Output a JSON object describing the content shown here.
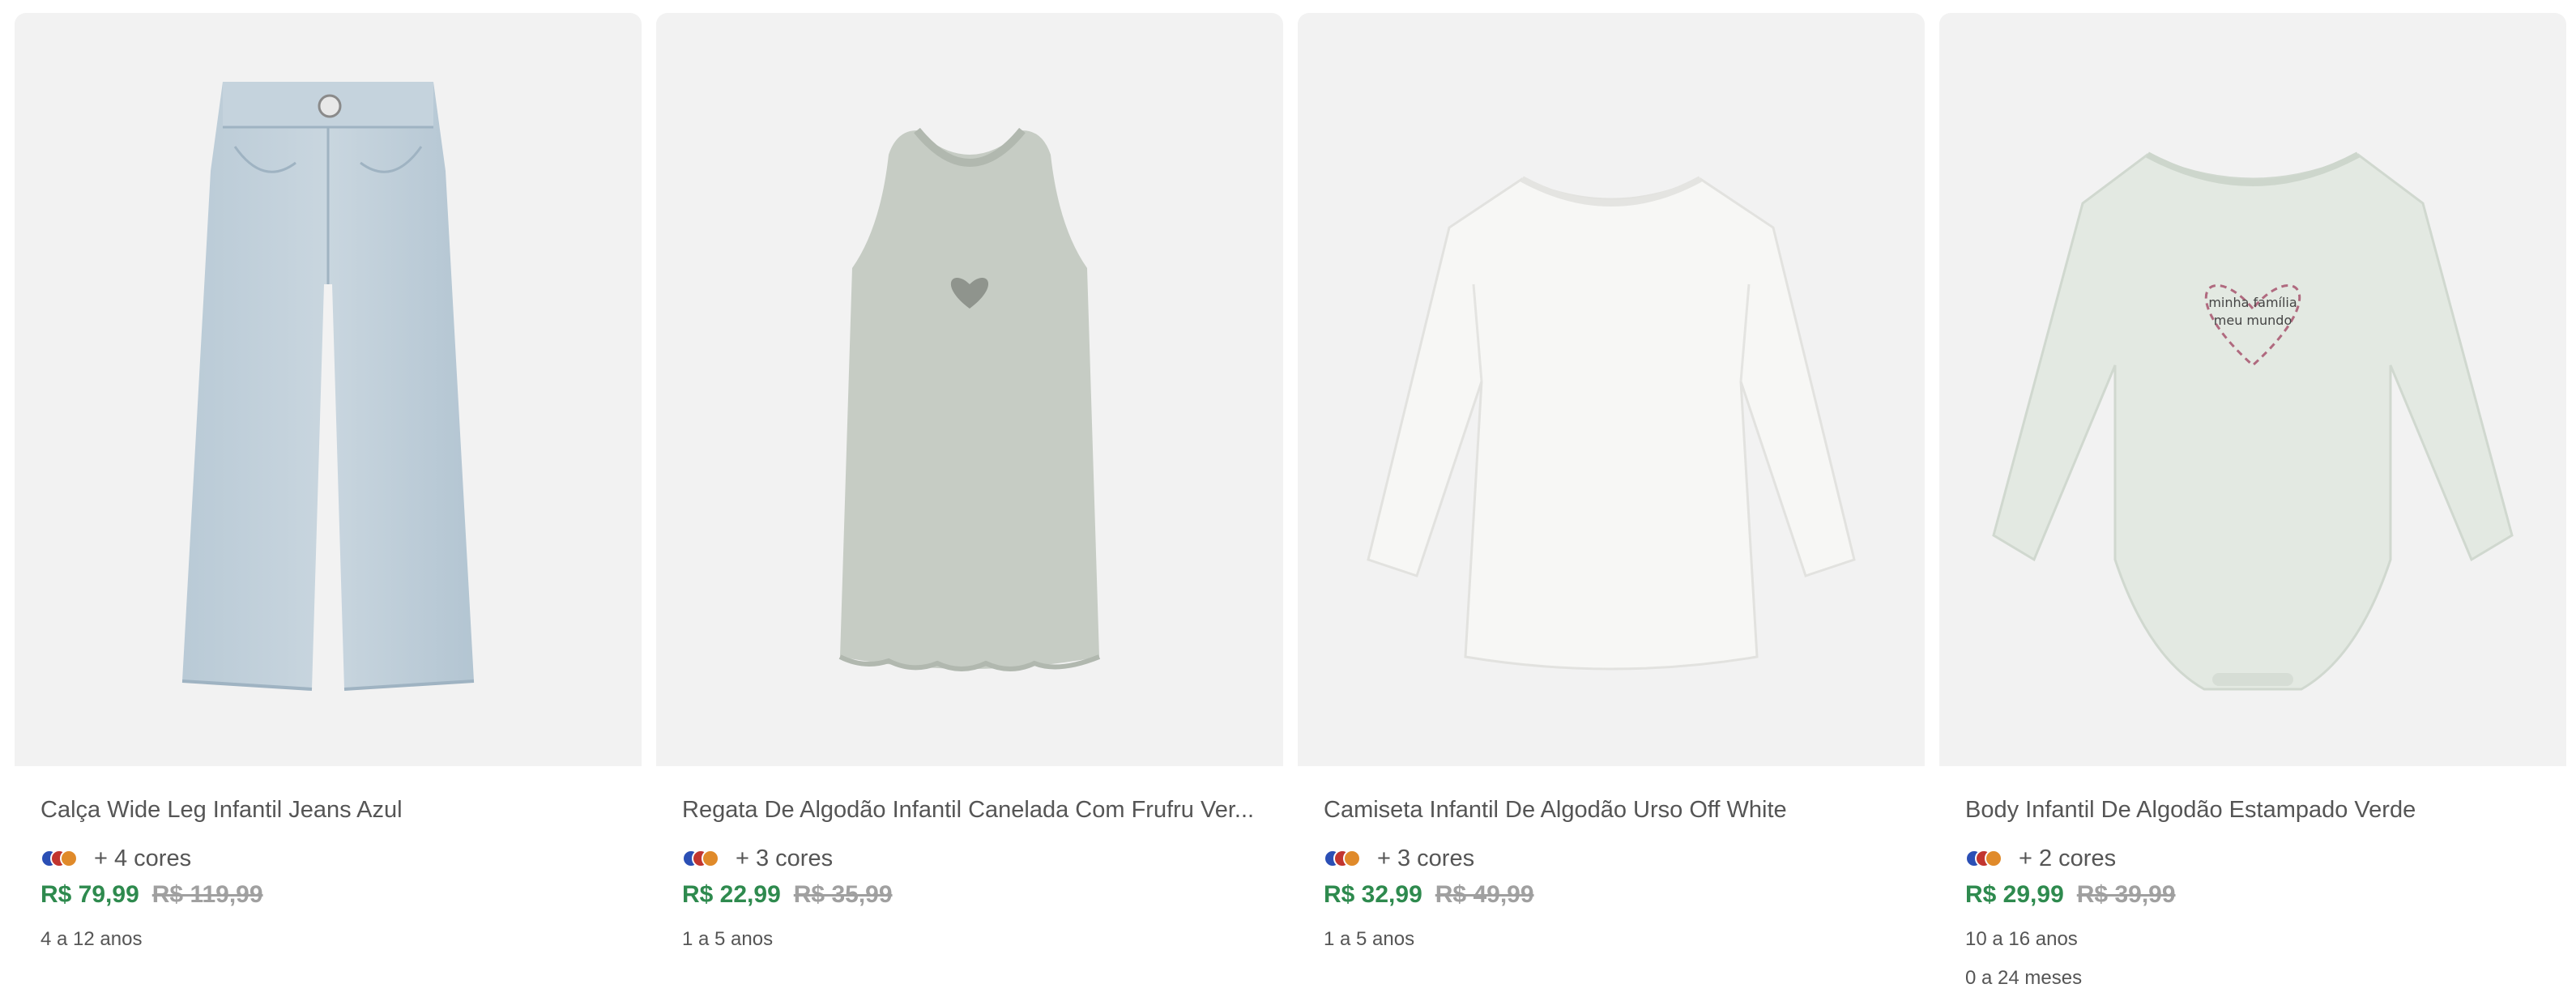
{
  "products": [
    {
      "title": "Calça Wide Leg Infantil Jeans Azul",
      "colors_text": "+ 4 cores",
      "swatches": [
        "#2b4fb5",
        "#c2352f",
        "#e08a2a"
      ],
      "price": "R$ 79,99",
      "old_price": "R$ 119,99",
      "ages": [
        "4 a 12 anos"
      ],
      "image_icon": "jeans-pants"
    },
    {
      "title": "Regata De Algodão Infantil Canelada Com Frufru Ver...",
      "colors_text": "+ 3 cores",
      "swatches": [
        "#2b4fb5",
        "#c2352f",
        "#e08a2a"
      ],
      "price": "R$ 22,99",
      "old_price": "R$ 35,99",
      "ages": [
        "1 a 5 anos"
      ],
      "image_icon": "tank-top"
    },
    {
      "title": "Camiseta Infantil De Algodão Urso Off White",
      "colors_text": "+ 3 cores",
      "swatches": [
        "#2b4fb5",
        "#c2352f",
        "#e08a2a"
      ],
      "price": "R$ 32,99",
      "old_price": "R$ 49,99",
      "ages": [
        "1 a 5 anos"
      ],
      "image_icon": "long-sleeve-shirt"
    },
    {
      "title": "Body Infantil De Algodão Estampado Verde",
      "colors_text": "+ 2 cores",
      "swatches": [
        "#2b4fb5",
        "#c2352f",
        "#e08a2a"
      ],
      "price": "R$ 29,99",
      "old_price": "R$ 39,99",
      "ages": [
        "10 a 16 anos",
        "0 a 24 meses"
      ],
      "image_icon": "baby-bodysuit",
      "print_text": [
        "minha família",
        "meu mundo"
      ]
    }
  ],
  "colors": {
    "price_green": "#2e8a4e",
    "old_price_gray": "#a0a0a0",
    "image_bg": "#f2f2f2"
  }
}
